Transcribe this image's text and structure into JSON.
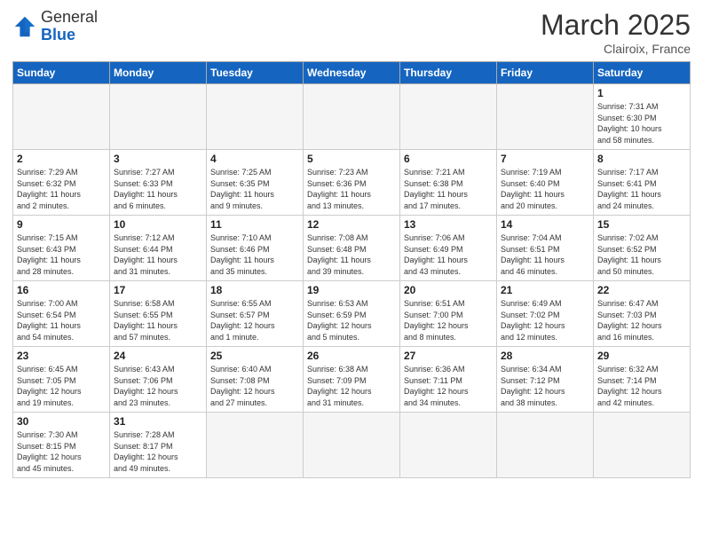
{
  "header": {
    "logo_general": "General",
    "logo_blue": "Blue",
    "month": "March 2025",
    "location": "Clairoix, France"
  },
  "weekdays": [
    "Sunday",
    "Monday",
    "Tuesday",
    "Wednesday",
    "Thursday",
    "Friday",
    "Saturday"
  ],
  "weeks": [
    [
      {
        "day": "",
        "info": ""
      },
      {
        "day": "",
        "info": ""
      },
      {
        "day": "",
        "info": ""
      },
      {
        "day": "",
        "info": ""
      },
      {
        "day": "",
        "info": ""
      },
      {
        "day": "",
        "info": ""
      },
      {
        "day": "1",
        "info": "Sunrise: 7:31 AM\nSunset: 6:30 PM\nDaylight: 10 hours\nand 58 minutes."
      }
    ],
    [
      {
        "day": "2",
        "info": "Sunrise: 7:29 AM\nSunset: 6:32 PM\nDaylight: 11 hours\nand 2 minutes."
      },
      {
        "day": "3",
        "info": "Sunrise: 7:27 AM\nSunset: 6:33 PM\nDaylight: 11 hours\nand 6 minutes."
      },
      {
        "day": "4",
        "info": "Sunrise: 7:25 AM\nSunset: 6:35 PM\nDaylight: 11 hours\nand 9 minutes."
      },
      {
        "day": "5",
        "info": "Sunrise: 7:23 AM\nSunset: 6:36 PM\nDaylight: 11 hours\nand 13 minutes."
      },
      {
        "day": "6",
        "info": "Sunrise: 7:21 AM\nSunset: 6:38 PM\nDaylight: 11 hours\nand 17 minutes."
      },
      {
        "day": "7",
        "info": "Sunrise: 7:19 AM\nSunset: 6:40 PM\nDaylight: 11 hours\nand 20 minutes."
      },
      {
        "day": "8",
        "info": "Sunrise: 7:17 AM\nSunset: 6:41 PM\nDaylight: 11 hours\nand 24 minutes."
      }
    ],
    [
      {
        "day": "9",
        "info": "Sunrise: 7:15 AM\nSunset: 6:43 PM\nDaylight: 11 hours\nand 28 minutes."
      },
      {
        "day": "10",
        "info": "Sunrise: 7:12 AM\nSunset: 6:44 PM\nDaylight: 11 hours\nand 31 minutes."
      },
      {
        "day": "11",
        "info": "Sunrise: 7:10 AM\nSunset: 6:46 PM\nDaylight: 11 hours\nand 35 minutes."
      },
      {
        "day": "12",
        "info": "Sunrise: 7:08 AM\nSunset: 6:48 PM\nDaylight: 11 hours\nand 39 minutes."
      },
      {
        "day": "13",
        "info": "Sunrise: 7:06 AM\nSunset: 6:49 PM\nDaylight: 11 hours\nand 43 minutes."
      },
      {
        "day": "14",
        "info": "Sunrise: 7:04 AM\nSunset: 6:51 PM\nDaylight: 11 hours\nand 46 minutes."
      },
      {
        "day": "15",
        "info": "Sunrise: 7:02 AM\nSunset: 6:52 PM\nDaylight: 11 hours\nand 50 minutes."
      }
    ],
    [
      {
        "day": "16",
        "info": "Sunrise: 7:00 AM\nSunset: 6:54 PM\nDaylight: 11 hours\nand 54 minutes."
      },
      {
        "day": "17",
        "info": "Sunrise: 6:58 AM\nSunset: 6:55 PM\nDaylight: 11 hours\nand 57 minutes."
      },
      {
        "day": "18",
        "info": "Sunrise: 6:55 AM\nSunset: 6:57 PM\nDaylight: 12 hours\nand 1 minute."
      },
      {
        "day": "19",
        "info": "Sunrise: 6:53 AM\nSunset: 6:59 PM\nDaylight: 12 hours\nand 5 minutes."
      },
      {
        "day": "20",
        "info": "Sunrise: 6:51 AM\nSunset: 7:00 PM\nDaylight: 12 hours\nand 8 minutes."
      },
      {
        "day": "21",
        "info": "Sunrise: 6:49 AM\nSunset: 7:02 PM\nDaylight: 12 hours\nand 12 minutes."
      },
      {
        "day": "22",
        "info": "Sunrise: 6:47 AM\nSunset: 7:03 PM\nDaylight: 12 hours\nand 16 minutes."
      }
    ],
    [
      {
        "day": "23",
        "info": "Sunrise: 6:45 AM\nSunset: 7:05 PM\nDaylight: 12 hours\nand 19 minutes."
      },
      {
        "day": "24",
        "info": "Sunrise: 6:43 AM\nSunset: 7:06 PM\nDaylight: 12 hours\nand 23 minutes."
      },
      {
        "day": "25",
        "info": "Sunrise: 6:40 AM\nSunset: 7:08 PM\nDaylight: 12 hours\nand 27 minutes."
      },
      {
        "day": "26",
        "info": "Sunrise: 6:38 AM\nSunset: 7:09 PM\nDaylight: 12 hours\nand 31 minutes."
      },
      {
        "day": "27",
        "info": "Sunrise: 6:36 AM\nSunset: 7:11 PM\nDaylight: 12 hours\nand 34 minutes."
      },
      {
        "day": "28",
        "info": "Sunrise: 6:34 AM\nSunset: 7:12 PM\nDaylight: 12 hours\nand 38 minutes."
      },
      {
        "day": "29",
        "info": "Sunrise: 6:32 AM\nSunset: 7:14 PM\nDaylight: 12 hours\nand 42 minutes."
      }
    ],
    [
      {
        "day": "30",
        "info": "Sunrise: 7:30 AM\nSunset: 8:15 PM\nDaylight: 12 hours\nand 45 minutes."
      },
      {
        "day": "31",
        "info": "Sunrise: 7:28 AM\nSunset: 8:17 PM\nDaylight: 12 hours\nand 49 minutes."
      },
      {
        "day": "",
        "info": ""
      },
      {
        "day": "",
        "info": ""
      },
      {
        "day": "",
        "info": ""
      },
      {
        "day": "",
        "info": ""
      },
      {
        "day": "",
        "info": ""
      }
    ]
  ]
}
